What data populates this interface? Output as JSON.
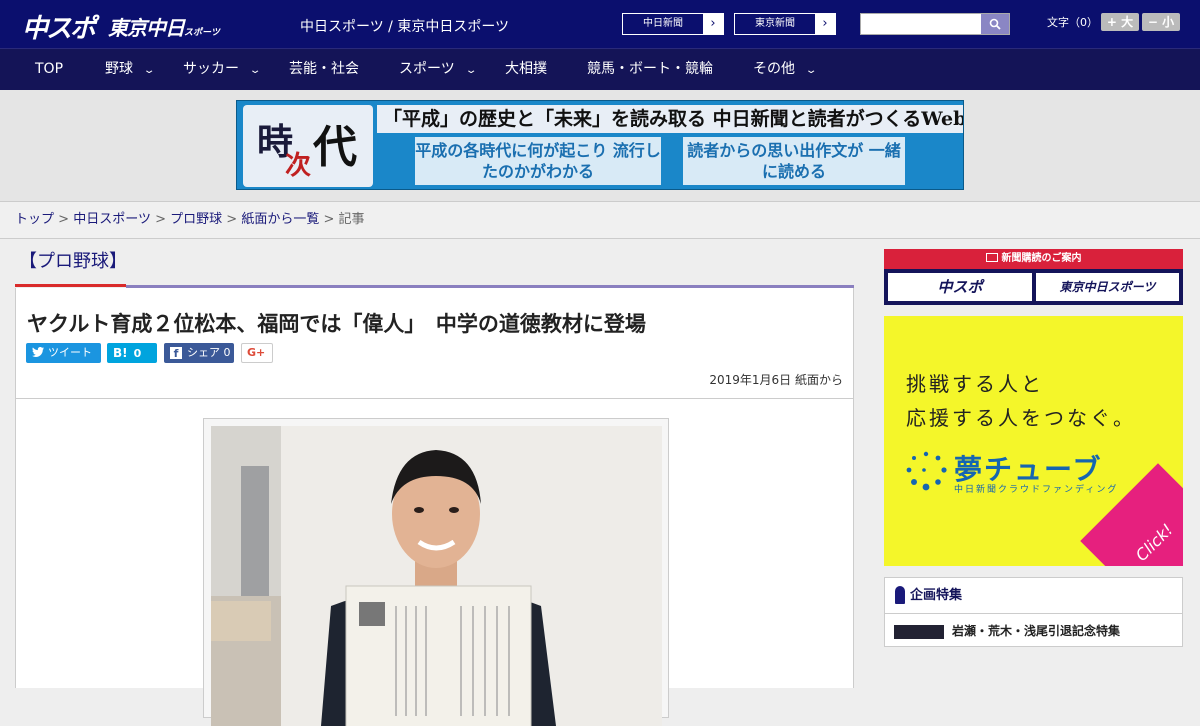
{
  "header": {
    "logo_primary": "中スポ",
    "logo_secondary": "東京中日",
    "logo_secondary_small": "スポーツ",
    "site_name": "中日スポーツ / 東京中日スポーツ",
    "paper_buttons": [
      {
        "label": "中日新聞",
        "arrow": "›"
      },
      {
        "label": "東京新聞",
        "arrow": "›"
      }
    ],
    "search_placeholder": "",
    "font_size_label": "文字（0）",
    "font_larger": "+ 大",
    "font_smaller": "− 小"
  },
  "nav": {
    "items": [
      {
        "label": "TOP",
        "has_menu": false
      },
      {
        "label": "野球",
        "has_menu": true
      },
      {
        "label": "サッカー",
        "has_menu": true
      },
      {
        "label": "芸能・社会",
        "has_menu": false
      },
      {
        "label": "スポーツ",
        "has_menu": true
      },
      {
        "label": "大相撲",
        "has_menu": false
      },
      {
        "label": "競馬・ボート・競輪",
        "has_menu": false
      },
      {
        "label": "その他",
        "has_menu": true
      }
    ],
    "chevron": "⌄"
  },
  "banner": {
    "logo_chars": [
      "時",
      "次",
      "代"
    ],
    "headline": "「平成」の歴史と「未来」を読み取る 中日新聞と読者がつくるWebサイト",
    "box_left": "平成の各時代に何が起こり 流行したのかがわかる",
    "box_right": "読者からの思い出作文が 一緒に読める"
  },
  "breadcrumb": {
    "items": [
      "トップ",
      "中日スポーツ",
      "プロ野球",
      "紙面から一覧"
    ],
    "current": "記事",
    "separator": ">"
  },
  "article": {
    "category": "【プロ野球】",
    "headline": "ヤクルト育成２位松本、福岡では「偉人」　中学の道徳教材に登場",
    "share": {
      "tweet": "ツイート",
      "hatena_icon": "B!",
      "hatena_count": "0",
      "facebook_label": "シェア",
      "facebook_count": "0",
      "gplus": "G+"
    },
    "date": "2019年1月6日",
    "source": "紙面から"
  },
  "sidebar": {
    "subscribe_header": "新聞購読のご案内",
    "subscribe_buttons": [
      "中スポ",
      "東京中日スポーツ"
    ],
    "ad": {
      "line1": "挑戦する人と",
      "line2": "応援する人をつなぐ。",
      "brand": "夢チューブ",
      "brand_sub": "中日新聞クラウドファンディング",
      "click": "Click!"
    },
    "special_header": "企画特集",
    "special_item": "岩瀬・荒木・浅尾引退記念特集"
  },
  "colors": {
    "header_bg": "#0b0f6e",
    "nav_bg": "#141457",
    "category_accent": "#d92a2a",
    "twitter": "#1b95e0",
    "hatena": "#00a4de",
    "facebook": "#3b5998",
    "ad_bg": "#f4f62a",
    "ad_click": "#e6207e"
  }
}
